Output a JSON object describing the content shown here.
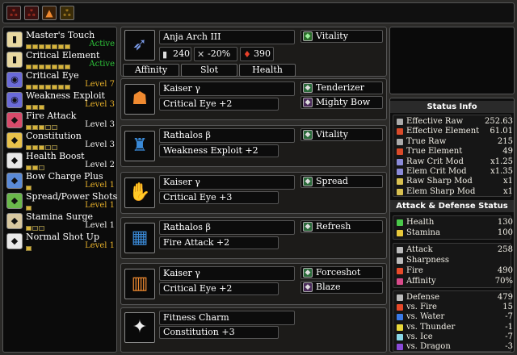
{
  "topbar": {
    "icons": [
      {
        "name": "skill-preset-icon-1",
        "glyph": "ஃ",
        "color": "#c0302a"
      },
      {
        "name": "skill-preset-icon-2",
        "glyph": "ஃ",
        "color": "#c0302a"
      },
      {
        "name": "skill-preset-icon-3",
        "glyph": "▲",
        "color": "#d06a1a"
      },
      {
        "name": "skill-preset-icon-4",
        "glyph": "ஃ",
        "color": "#d6a020"
      }
    ]
  },
  "skills": [
    {
      "name": "Master's Touch",
      "level": "Active",
      "filled": 7,
      "total": 7,
      "icon": "#e8d8a0",
      "glyph": "▮",
      "status": "act"
    },
    {
      "name": "Critical Element",
      "level": "Active",
      "filled": 7,
      "total": 7,
      "icon": "#e8d8a0",
      "glyph": "▮",
      "status": "act"
    },
    {
      "name": "Critical Eye",
      "level": "Level 7",
      "filled": 7,
      "total": 7,
      "icon": "#6a6ad8",
      "glyph": "◉",
      "status": ""
    },
    {
      "name": "Weakness Exploit",
      "level": "Level 3",
      "filled": 3,
      "total": 3,
      "icon": "#6a6ad8",
      "glyph": "◉",
      "status": ""
    },
    {
      "name": "Fire Attack",
      "level": "Level 3",
      "filled": 3,
      "total": 5,
      "icon": "#d84a6a",
      "glyph": "◆",
      "status": "w"
    },
    {
      "name": "Constitution",
      "level": "Level 3",
      "filled": 3,
      "total": 5,
      "icon": "#e8c24a",
      "glyph": "◆",
      "status": "w"
    },
    {
      "name": "Health Boost",
      "level": "Level 2",
      "filled": 2,
      "total": 3,
      "icon": "#e8e8e8",
      "glyph": "◆",
      "status": "w"
    },
    {
      "name": "Bow Charge Plus",
      "level": "Level 1",
      "filled": 1,
      "total": 1,
      "icon": "#5a8ad8",
      "glyph": "◆",
      "status": ""
    },
    {
      "name": "Spread/Power Shots",
      "level": "Level 1",
      "filled": 1,
      "total": 1,
      "icon": "#6ab84a",
      "glyph": "◆",
      "status": ""
    },
    {
      "name": "Stamina Surge",
      "level": "Level 1",
      "filled": 1,
      "total": 3,
      "icon": "#d8c8a0",
      "glyph": "◆",
      "status": "w"
    },
    {
      "name": "Normal Shot Up",
      "level": "Level 1",
      "filled": 1,
      "total": 1,
      "icon": "#e8e8e8",
      "glyph": "◆",
      "status": ""
    }
  ],
  "weapon": {
    "name": "Anja Arch III",
    "attack": "240",
    "affinity": "-20%",
    "element": "390",
    "deco": "Vitality",
    "tabs": [
      "Affinity",
      "Slot",
      "Health"
    ]
  },
  "armor": [
    {
      "name": "Kaiser γ",
      "skill": "Critical Eye +2",
      "decos": [
        "Tenderizer",
        "Mighty Bow"
      ],
      "glyph": "☗",
      "color": "#f08a30"
    },
    {
      "name": "Rathalos β",
      "skill": "Weakness Exploit +2",
      "decos": [
        "Vitality"
      ],
      "glyph": "♜",
      "color": "#3a8ad8"
    },
    {
      "name": "Kaiser γ",
      "skill": "Critical Eye +3",
      "decos": [
        "Spread"
      ],
      "glyph": "✋",
      "color": "#f08a30"
    },
    {
      "name": "Rathalos β",
      "skill": "Fire Attack +2",
      "decos": [
        "Refresh"
      ],
      "glyph": "▦",
      "color": "#3a8ad8"
    },
    {
      "name": "Kaiser γ",
      "skill": "Critical Eye +2",
      "decos": [
        "Forceshot",
        "Blaze"
      ],
      "glyph": "▥",
      "color": "#f08a30"
    }
  ],
  "charm": {
    "name": "Fitness Charm",
    "skill": "Constitution +3",
    "glyph": "✦"
  },
  "status": {
    "header": "Status Info",
    "rows": [
      {
        "label": "Effective Raw",
        "value": "252.63",
        "color": "#aaa"
      },
      {
        "label": "Effective Element",
        "value": "61.01",
        "color": "#d84a2a"
      },
      {
        "label": "True Raw",
        "value": "215",
        "color": "#aaa"
      },
      {
        "label": "True Element",
        "value": "49",
        "color": "#d84a2a"
      },
      {
        "label": "Raw Crit Mod",
        "value": "x1.25",
        "color": "#8a8ad8"
      },
      {
        "label": "Elem Crit Mod",
        "value": "x1.35",
        "color": "#8a8ad8"
      },
      {
        "label": "Raw Sharp Mod",
        "value": "x1",
        "color": "#d8c050"
      },
      {
        "label": "Elem Sharp Mod",
        "value": "x1",
        "color": "#d8c050"
      }
    ],
    "header2": "Attack & Defense Status",
    "vitals": [
      {
        "label": "Health",
        "value": "130",
        "color": "#4ac84a"
      },
      {
        "label": "Stamina",
        "value": "100",
        "color": "#e8c83a"
      }
    ],
    "attack": [
      {
        "label": "Attack",
        "value": "258",
        "color": "#bbb"
      },
      {
        "label": "Sharpness",
        "value": "",
        "color": "#bbb"
      },
      {
        "label": "Fire",
        "value": "490",
        "color": "#e84a2a"
      },
      {
        "label": "Affinity",
        "value": "70%",
        "color": "#d84a8a"
      }
    ],
    "defense": [
      {
        "label": "Defense",
        "value": "479",
        "color": "#bbb"
      },
      {
        "label": "vs. Fire",
        "value": "15",
        "color": "#e84a2a"
      },
      {
        "label": "vs. Water",
        "value": "-7",
        "color": "#3a7ae8"
      },
      {
        "label": "vs. Thunder",
        "value": "-1",
        "color": "#e8d83a"
      },
      {
        "label": "vs. Ice",
        "value": "-7",
        "color": "#8ad8e8"
      },
      {
        "label": "vs. Dragon",
        "value": "-3",
        "color": "#8a4ad8"
      }
    ]
  }
}
